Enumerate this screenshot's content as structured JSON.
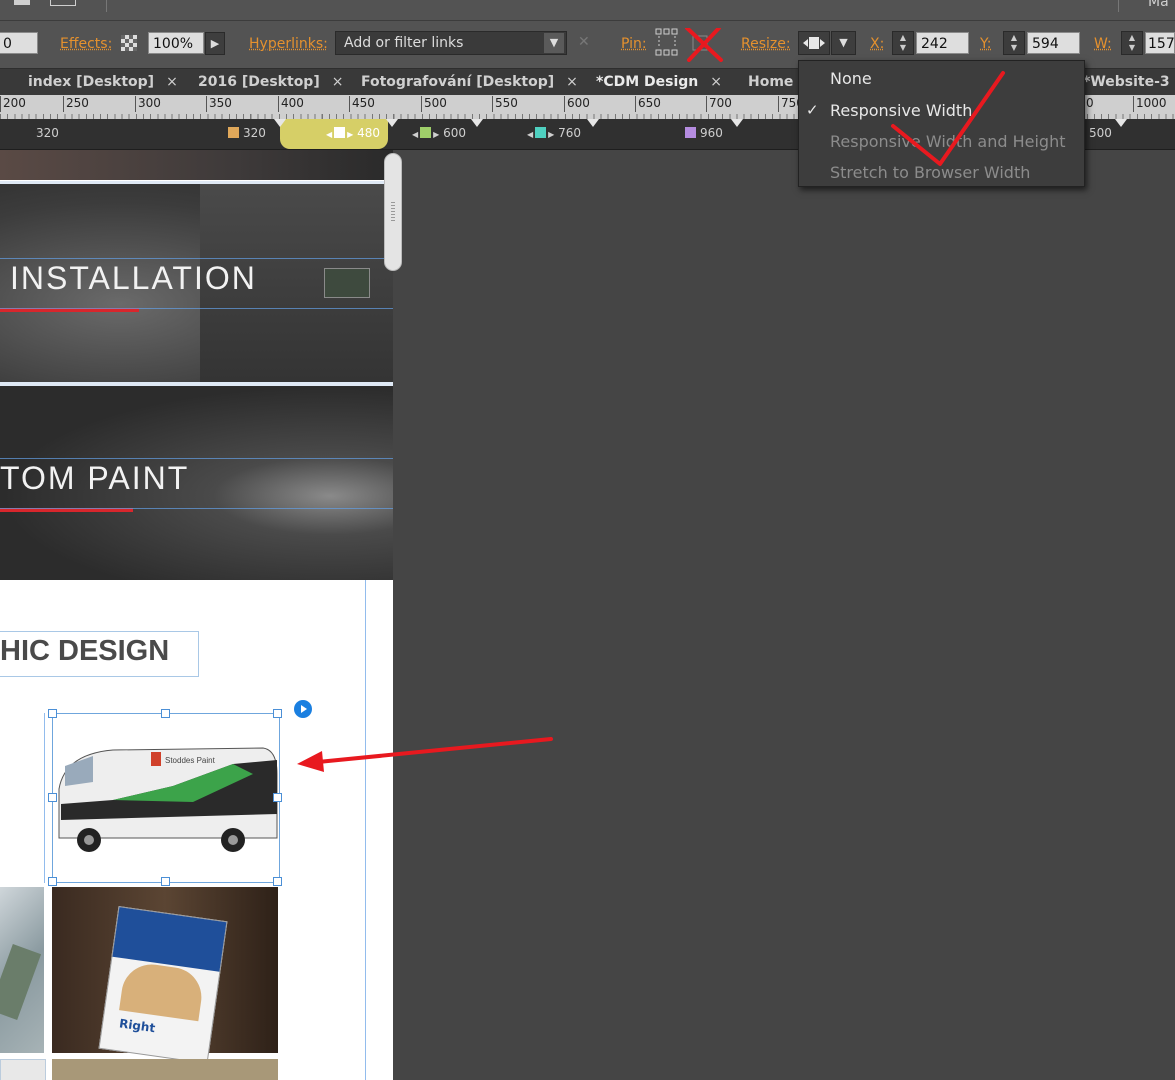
{
  "topstrip": {
    "right_text": "Ma"
  },
  "controls": {
    "first_field_value": "0",
    "effects_label": "Effects:",
    "effects_value": "100%",
    "hyperlinks_label": "Hyperlinks:",
    "hyperlinks_placeholder": "Add or filter links",
    "pin_label": "Pin:",
    "resize_label": "Resize:",
    "x_label": "X:",
    "x_value": "242",
    "y_label": "Y:",
    "y_value": "594",
    "w_label": "W:",
    "w_value": "157"
  },
  "tabs": [
    {
      "label": "index [Desktop]",
      "close": "×"
    },
    {
      "label": "2016 [Desktop]",
      "close": "×"
    },
    {
      "label": "Fotografování [Desktop]",
      "close": "×"
    },
    {
      "label": "*CDM Design",
      "close": "×"
    },
    {
      "label": "Home"
    },
    {
      "label": "*Website-3"
    }
  ],
  "ruler": {
    "ticks": [
      "200",
      "250",
      "300",
      "350",
      "400",
      "450",
      "500",
      "550",
      "600",
      "650",
      "700",
      "750",
      "1000"
    ],
    "partial_right": "0"
  },
  "breakpoints": {
    "left_label": "320",
    "items": [
      {
        "label": "320",
        "color": "#e0a85a"
      },
      {
        "label": "480",
        "color": "#ffffff"
      },
      {
        "label": "600",
        "color": "#9fcf6a"
      },
      {
        "label": "760",
        "color": "#4fd0c0"
      },
      {
        "label": "960",
        "color": "#b58ce0"
      }
    ],
    "far_label": "500"
  },
  "page": {
    "banner1_text": "INSTALLATION",
    "banner2_text": "TOM PAINT",
    "heading_text": "HIC DESIGN",
    "van_brand": "Stoddes Paint",
    "card_brand": "Right"
  },
  "resize_menu": {
    "items": [
      {
        "label": "None",
        "checked": false,
        "enabled": true
      },
      {
        "label": "Responsive Width",
        "checked": true,
        "enabled": true
      },
      {
        "label": "Responsive Width and Height",
        "checked": false,
        "enabled": false
      },
      {
        "label": "Stretch to Browser Width",
        "checked": false,
        "enabled": false
      }
    ]
  },
  "colors": {
    "accent_label": "#e5912e",
    "annotation_red": "#e8191f",
    "banner_red": "#d8262c",
    "active_breakpoint": "#d6cf67"
  },
  "icons": [
    "checkerboard-icon",
    "arrow-right-icon",
    "dropdown-arrow-icon",
    "clear-icon",
    "pin-icon",
    "resize-icon",
    "check-icon",
    "spin-up-down-icon"
  ]
}
